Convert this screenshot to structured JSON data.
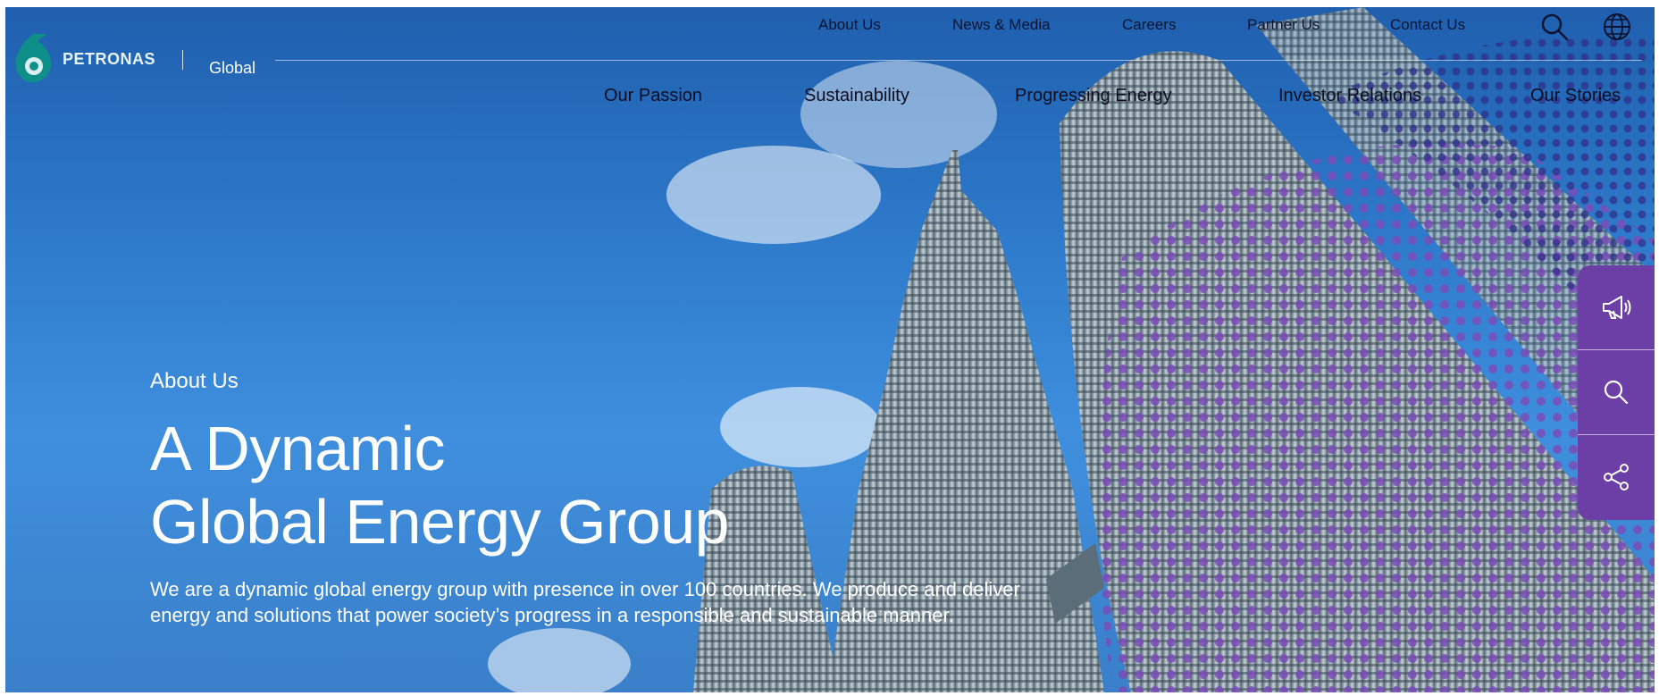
{
  "brand": {
    "name": "PETRONAS",
    "region": "Global"
  },
  "utility_nav": {
    "items": [
      "About Us",
      "News & Media",
      "Careers",
      "Partner Us",
      "Contact Us"
    ],
    "icons": [
      "search-icon",
      "globe-icon"
    ]
  },
  "main_nav": {
    "items": [
      "Our Passion",
      "Sustainability",
      "Progressing Energy",
      "Investor Relations",
      "Our Stories"
    ]
  },
  "hero": {
    "eyebrow": "About Us",
    "headline_line1": "A Dynamic",
    "headline_line2": "Global Energy Group",
    "description": "We are a dynamic global energy group with presence in over 100 countries. We produce and deliver energy and solutions that power society’s progress in a responsible and sustainable manner."
  },
  "side_rail": {
    "icons": [
      "megaphone-icon",
      "search-icon",
      "share-icon"
    ]
  },
  "colors": {
    "accent_purple": "#6b3fa5",
    "brand_teal": "#0f8f8a",
    "sky_blue": "#2f7bcc"
  }
}
